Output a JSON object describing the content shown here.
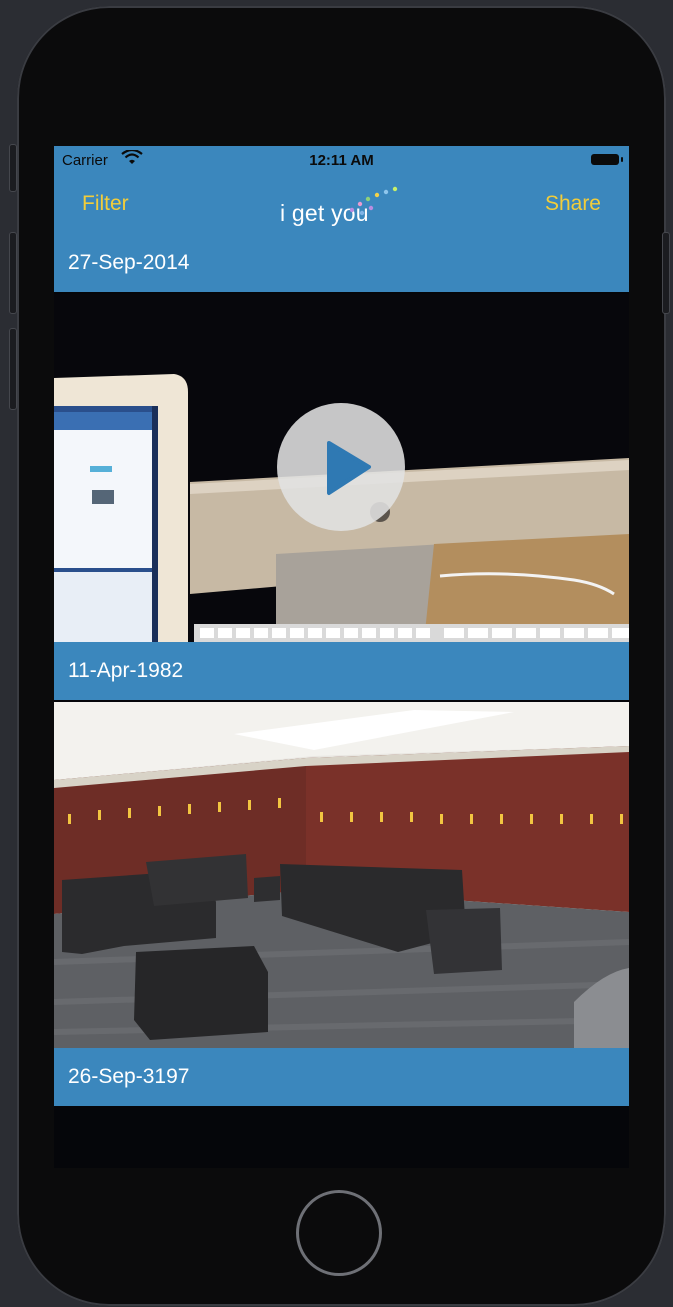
{
  "status_bar": {
    "carrier": "Carrier",
    "wifi_icon": "wifi-icon",
    "time": "12:11 AM",
    "battery_icon": "battery-icon"
  },
  "nav": {
    "filter_label": "Filter",
    "logo_text": "i get you",
    "share_label": "Share"
  },
  "feed": [
    {
      "date": "27-Sep-2014",
      "media_type": "video",
      "play_icon": "play-icon"
    },
    {
      "date": "11-Apr-1982",
      "media_type": "photo"
    },
    {
      "date": "26-Sep-3197"
    }
  ],
  "colors": {
    "bar": "#3b87bd",
    "accent": "#f2cd3a",
    "text": "#ffffff"
  }
}
